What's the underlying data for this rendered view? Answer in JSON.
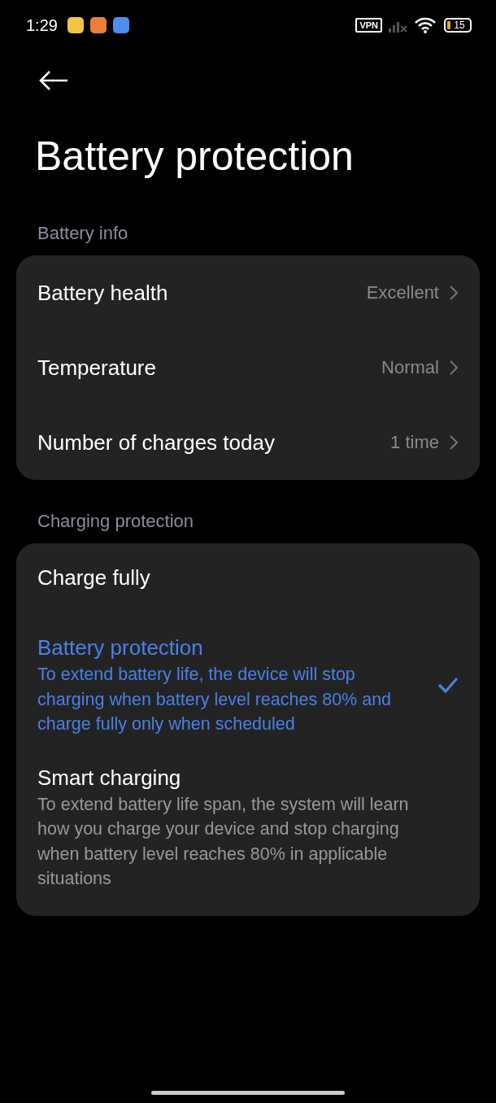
{
  "status_bar": {
    "time": "1:29",
    "vpn": "VPN",
    "battery": "15"
  },
  "title": "Battery protection",
  "info_section": {
    "header": "Battery info",
    "rows": [
      {
        "label": "Battery health",
        "value": "Excellent"
      },
      {
        "label": "Temperature",
        "value": "Normal"
      },
      {
        "label": "Number of charges today",
        "value": "1 time"
      }
    ]
  },
  "charging_section": {
    "header": "Charging protection",
    "options": [
      {
        "title": "Charge fully",
        "selected": false
      },
      {
        "title": "Battery protection",
        "description": "To extend battery life, the device will stop charging when battery level reaches 80% and charge fully only when scheduled",
        "selected": true
      },
      {
        "title": "Smart charging",
        "description": "To extend battery life span, the system will learn how you charge your device and stop charging when battery level reaches 80% in applicable situations",
        "selected": false
      }
    ]
  }
}
